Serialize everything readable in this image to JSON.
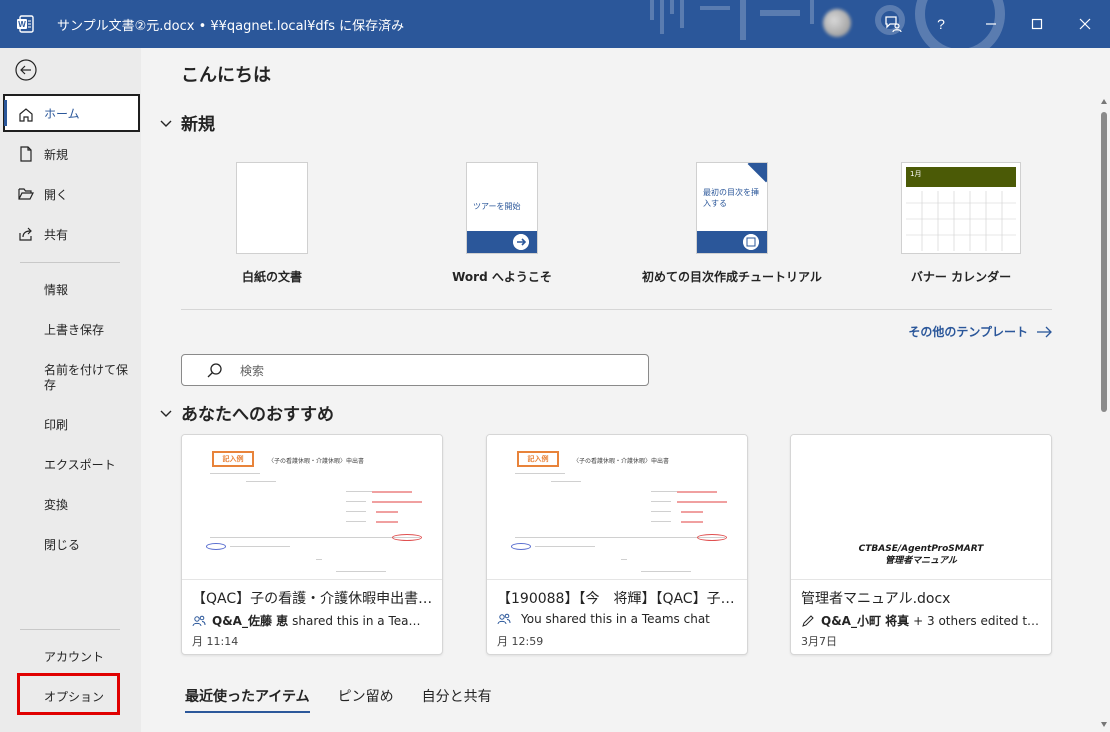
{
  "titlebar": {
    "title": "サンプル文書②元.docx • ¥¥qagnet.local¥dfs に保存済み",
    "accent": "#2b579a"
  },
  "sidebar": {
    "items": [
      {
        "label": "ホーム",
        "icon": "home-icon"
      },
      {
        "label": "新規",
        "icon": "new-document-icon"
      },
      {
        "label": "開く",
        "icon": "folder-open-icon"
      },
      {
        "label": "共有",
        "icon": "share-icon"
      }
    ],
    "text_items": [
      "情報",
      "上書き保存",
      "名前を付けて保存",
      "印刷",
      "エクスポート",
      "変換",
      "閉じる"
    ],
    "bottom_items": [
      "アカウント",
      "オプション"
    ],
    "highlight_color": "#e00000"
  },
  "main": {
    "greeting": "こんにちは",
    "new_section": "新規",
    "templates": [
      {
        "name": "白紙の文書",
        "thumb_text": ""
      },
      {
        "name": "Word へようこそ",
        "thumb_text": "ツアーを開始"
      },
      {
        "name": "初めての目次作成チュートリアル",
        "thumb_text": "最初の目次を挿入する"
      },
      {
        "name": "バナー カレンダー",
        "thumb_text": "1月"
      }
    ],
    "more_templates": "その他のテンプレート",
    "search_placeholder": "検索",
    "recommended_section": "あなたへのおすすめ",
    "cards": [
      {
        "title": "【QAC】子の看護・介護休暇申出書…",
        "actor": "Q&A_佐藤 恵",
        "action": "shared this in a Tea…",
        "time": "月 11:14",
        "stamp": "記入例",
        "doc_header": "〈子の看護休暇・介護休暇〉申出書"
      },
      {
        "title": "【190088】【今　将輝】【QAC】子の…",
        "actor": "",
        "action": "You shared this in a Teams chat",
        "time": "月 12:59",
        "stamp": "記入例",
        "doc_header": "〈子の看護休暇・介護休暇〉申出書"
      },
      {
        "title": "管理者マニュアル.docx",
        "actor": "Q&A_小町 将真",
        "action": "+ 3 others edited t…",
        "time": "3月7日",
        "preview_title": "CTBASE/AgentProSMART",
        "preview_subtitle": "管理者マニュアル"
      }
    ],
    "tabs": [
      "最近使ったアイテム",
      "ピン留め",
      "自分と共有"
    ]
  }
}
